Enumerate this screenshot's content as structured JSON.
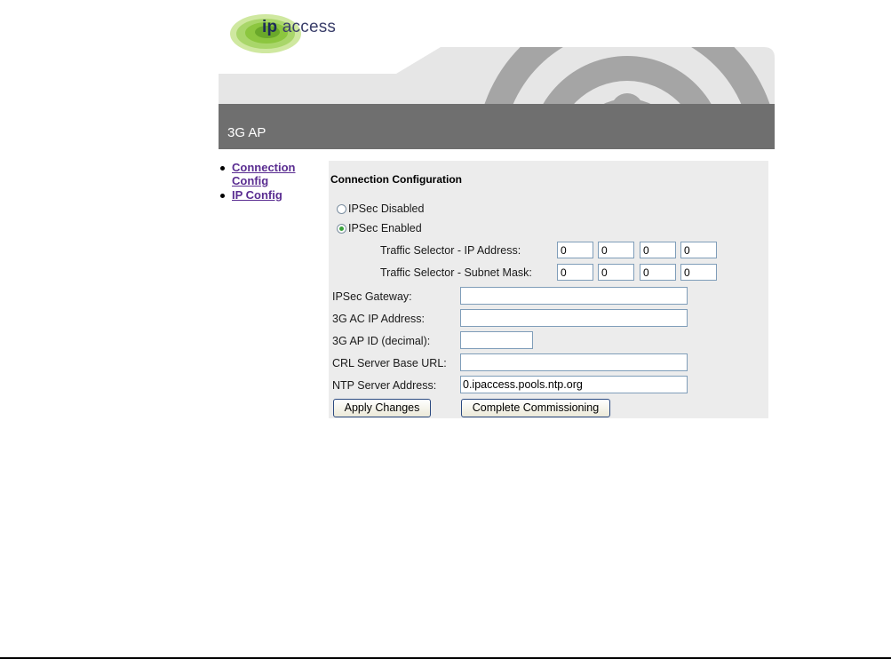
{
  "logo": {
    "text_bold": "ip",
    "text": "access"
  },
  "header": {
    "title": "3G AP"
  },
  "nav": {
    "items": [
      {
        "line1": "Connection",
        "line2": "Config"
      },
      {
        "line1": "IP Config",
        "line2": ""
      }
    ]
  },
  "form": {
    "title": "Connection Configuration",
    "ipsec_disabled_label": "IPSec Disabled",
    "ipsec_enabled_label": "IPSec Enabled",
    "ipsec_selected": "enabled",
    "traffic_ip_label": "Traffic Selector - IP Address:",
    "traffic_ip": [
      "0",
      "0",
      "0",
      "0"
    ],
    "traffic_mask_label": "Traffic Selector - Subnet Mask:",
    "traffic_mask": [
      "0",
      "0",
      "0",
      "0"
    ],
    "gateway_label": "IPSec Gateway:",
    "gateway_value": "",
    "ac_ip_label": "3G AC IP Address:",
    "ac_ip_value": "",
    "ap_id_label": "3G AP ID (decimal):",
    "ap_id_value": "",
    "crl_label": "CRL Server Base URL:",
    "crl_value": "",
    "ntp_label": "NTP Server Address:",
    "ntp_value": "0.ipaccess.pools.ntp.org",
    "apply_button": "Apply Changes",
    "commission_button": "Complete Commissioning"
  },
  "colors": {
    "title_bar": "#6f6f6f",
    "panel_bg": "#ececec",
    "link": "#5a2d91",
    "logo_green": "#8cc63f"
  }
}
